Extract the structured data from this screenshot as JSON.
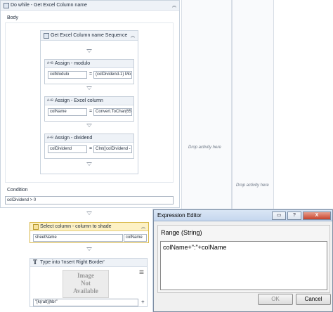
{
  "do_while": {
    "title": "Do while - Get Excel Column name",
    "body_label": "Body",
    "condition_label": "Condition",
    "condition_value": "colDividend > 0"
  },
  "sequence": {
    "title": "Get Excel Column name Sequence",
    "assigns": [
      {
        "title": "Assign - modulo",
        "to": "colModulo",
        "equals": "=",
        "value": "(colDividend-1) Mo"
      },
      {
        "title": "Assign - Excel column",
        "to": "colName",
        "equals": "=",
        "value": "Convert.ToChar(65"
      },
      {
        "title": "Assign - dividend",
        "to": "colDividend",
        "equals": "=",
        "value": "CInt((colDividend -"
      }
    ]
  },
  "drop_zones": {
    "text_1": "Drop activity here",
    "text_2": "Drop activity here"
  },
  "select_column": {
    "title": "Select column - column to shade",
    "sheet_value": "sheetName",
    "col_value": "colName"
  },
  "type_into": {
    "title": "Type into 'Insert Right Border'",
    "image_line1": "Image",
    "image_line2": "Not",
    "image_line3": "Available",
    "input_value": "\"[k(ralt)]hbr\"",
    "plus": "+"
  },
  "dialog": {
    "title": "Expression Editor",
    "help_btn": "?",
    "close_btn": "X",
    "section_label": "Range (String)",
    "expression": "colName+\":\"+colName",
    "ok_label": "OK",
    "cancel_label": "Cancel"
  },
  "icons": {
    "collapse": "double-chevron-up",
    "activity": "activity-icon",
    "assign": "A+B",
    "type_into": "T"
  }
}
